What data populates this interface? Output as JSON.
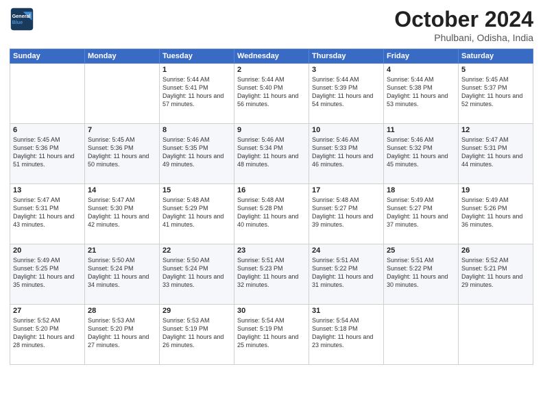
{
  "header": {
    "logo_line1": "General",
    "logo_line2": "Blue",
    "month": "October 2024",
    "location": "Phulbani, Odisha, India"
  },
  "weekdays": [
    "Sunday",
    "Monday",
    "Tuesday",
    "Wednesday",
    "Thursday",
    "Friday",
    "Saturday"
  ],
  "weeks": [
    [
      {
        "day": "",
        "info": ""
      },
      {
        "day": "",
        "info": ""
      },
      {
        "day": "1",
        "info": "Sunrise: 5:44 AM\nSunset: 5:41 PM\nDaylight: 11 hours and 57 minutes."
      },
      {
        "day": "2",
        "info": "Sunrise: 5:44 AM\nSunset: 5:40 PM\nDaylight: 11 hours and 56 minutes."
      },
      {
        "day": "3",
        "info": "Sunrise: 5:44 AM\nSunset: 5:39 PM\nDaylight: 11 hours and 54 minutes."
      },
      {
        "day": "4",
        "info": "Sunrise: 5:44 AM\nSunset: 5:38 PM\nDaylight: 11 hours and 53 minutes."
      },
      {
        "day": "5",
        "info": "Sunrise: 5:45 AM\nSunset: 5:37 PM\nDaylight: 11 hours and 52 minutes."
      }
    ],
    [
      {
        "day": "6",
        "info": "Sunrise: 5:45 AM\nSunset: 5:36 PM\nDaylight: 11 hours and 51 minutes."
      },
      {
        "day": "7",
        "info": "Sunrise: 5:45 AM\nSunset: 5:36 PM\nDaylight: 11 hours and 50 minutes."
      },
      {
        "day": "8",
        "info": "Sunrise: 5:46 AM\nSunset: 5:35 PM\nDaylight: 11 hours and 49 minutes."
      },
      {
        "day": "9",
        "info": "Sunrise: 5:46 AM\nSunset: 5:34 PM\nDaylight: 11 hours and 48 minutes."
      },
      {
        "day": "10",
        "info": "Sunrise: 5:46 AM\nSunset: 5:33 PM\nDaylight: 11 hours and 46 minutes."
      },
      {
        "day": "11",
        "info": "Sunrise: 5:46 AM\nSunset: 5:32 PM\nDaylight: 11 hours and 45 minutes."
      },
      {
        "day": "12",
        "info": "Sunrise: 5:47 AM\nSunset: 5:31 PM\nDaylight: 11 hours and 44 minutes."
      }
    ],
    [
      {
        "day": "13",
        "info": "Sunrise: 5:47 AM\nSunset: 5:31 PM\nDaylight: 11 hours and 43 minutes."
      },
      {
        "day": "14",
        "info": "Sunrise: 5:47 AM\nSunset: 5:30 PM\nDaylight: 11 hours and 42 minutes."
      },
      {
        "day": "15",
        "info": "Sunrise: 5:48 AM\nSunset: 5:29 PM\nDaylight: 11 hours and 41 minutes."
      },
      {
        "day": "16",
        "info": "Sunrise: 5:48 AM\nSunset: 5:28 PM\nDaylight: 11 hours and 40 minutes."
      },
      {
        "day": "17",
        "info": "Sunrise: 5:48 AM\nSunset: 5:27 PM\nDaylight: 11 hours and 39 minutes."
      },
      {
        "day": "18",
        "info": "Sunrise: 5:49 AM\nSunset: 5:27 PM\nDaylight: 11 hours and 37 minutes."
      },
      {
        "day": "19",
        "info": "Sunrise: 5:49 AM\nSunset: 5:26 PM\nDaylight: 11 hours and 36 minutes."
      }
    ],
    [
      {
        "day": "20",
        "info": "Sunrise: 5:49 AM\nSunset: 5:25 PM\nDaylight: 11 hours and 35 minutes."
      },
      {
        "day": "21",
        "info": "Sunrise: 5:50 AM\nSunset: 5:24 PM\nDaylight: 11 hours and 34 minutes."
      },
      {
        "day": "22",
        "info": "Sunrise: 5:50 AM\nSunset: 5:24 PM\nDaylight: 11 hours and 33 minutes."
      },
      {
        "day": "23",
        "info": "Sunrise: 5:51 AM\nSunset: 5:23 PM\nDaylight: 11 hours and 32 minutes."
      },
      {
        "day": "24",
        "info": "Sunrise: 5:51 AM\nSunset: 5:22 PM\nDaylight: 11 hours and 31 minutes."
      },
      {
        "day": "25",
        "info": "Sunrise: 5:51 AM\nSunset: 5:22 PM\nDaylight: 11 hours and 30 minutes."
      },
      {
        "day": "26",
        "info": "Sunrise: 5:52 AM\nSunset: 5:21 PM\nDaylight: 11 hours and 29 minutes."
      }
    ],
    [
      {
        "day": "27",
        "info": "Sunrise: 5:52 AM\nSunset: 5:20 PM\nDaylight: 11 hours and 28 minutes."
      },
      {
        "day": "28",
        "info": "Sunrise: 5:53 AM\nSunset: 5:20 PM\nDaylight: 11 hours and 27 minutes."
      },
      {
        "day": "29",
        "info": "Sunrise: 5:53 AM\nSunset: 5:19 PM\nDaylight: 11 hours and 26 minutes."
      },
      {
        "day": "30",
        "info": "Sunrise: 5:54 AM\nSunset: 5:19 PM\nDaylight: 11 hours and 25 minutes."
      },
      {
        "day": "31",
        "info": "Sunrise: 5:54 AM\nSunset: 5:18 PM\nDaylight: 11 hours and 23 minutes."
      },
      {
        "day": "",
        "info": ""
      },
      {
        "day": "",
        "info": ""
      }
    ]
  ]
}
